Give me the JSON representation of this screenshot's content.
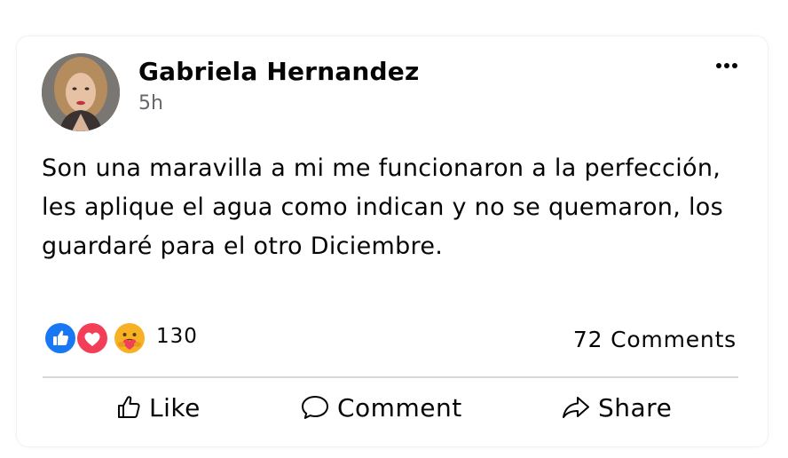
{
  "post": {
    "author": "Gabriela Hernandez",
    "time": "5h",
    "text": "Son una maravilla a mi me funcionaron a la perfección, les aplique el agua como indican y no se quemaron, los guardaré para el otro Diciembre.",
    "reactions": {
      "icons": [
        "like-reaction-icon",
        "love-reaction-icon",
        "care-reaction-icon"
      ],
      "count": "130"
    },
    "comments_count": "72 Comments",
    "actions": {
      "like": "Like",
      "comment": "Comment",
      "share": "Share"
    }
  },
  "colors": {
    "like_blue": "#1877F2",
    "love_red": "#F33E58",
    "care_yellow": "#F7B125",
    "text": "#050505",
    "muted": "#65676B",
    "divider": "#D8D8D8"
  }
}
